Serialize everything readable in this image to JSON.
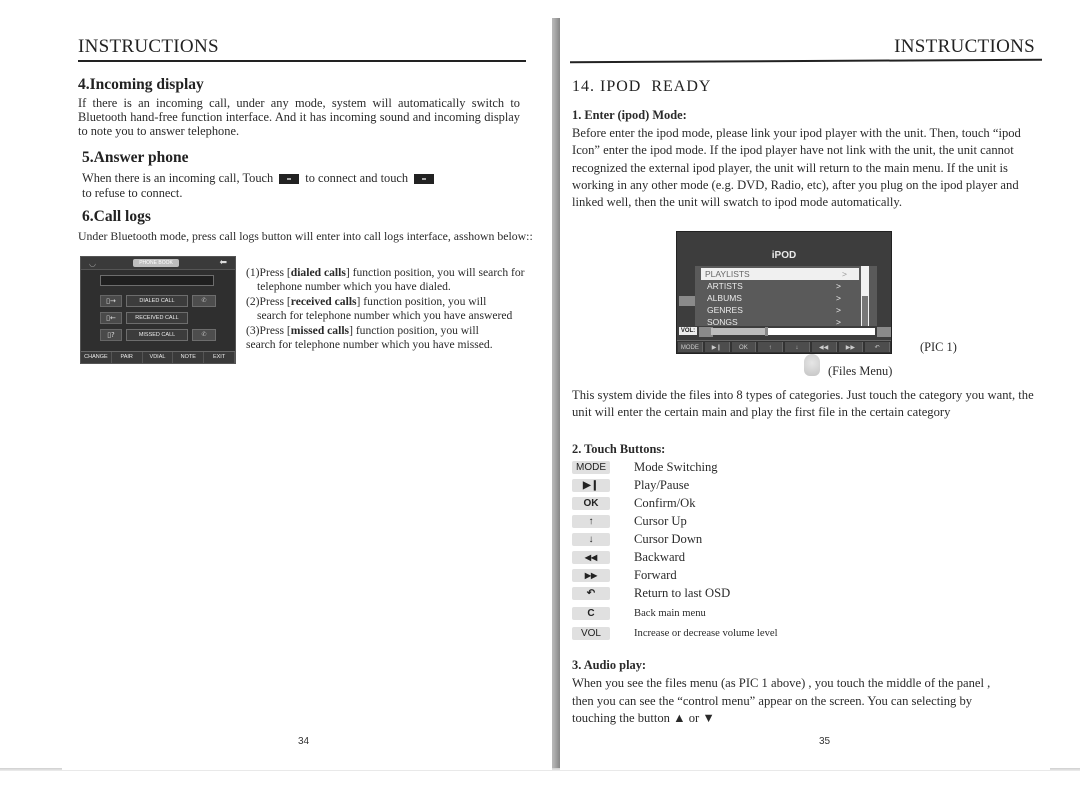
{
  "left_page": {
    "header": "INSTRUCTIONS",
    "sections": {
      "incoming": {
        "title": "4.Incoming display",
        "text": "If there is an incoming call, under any mode, system will automatically switch to Bluetooth hand-free function interface. And it has incoming sound and incoming display to note you to answer telephone."
      },
      "answer": {
        "title": "5.Answer phone",
        "text_part1": "When there is an incoming call, Touch",
        "text_part2": "to connect and touch",
        "text_part3": "to refuse to connect."
      },
      "call_logs": {
        "title": "6.Call logs",
        "text": "Under Bluetooth mode, press call logs button will enter into  call logs interface, asshown below::",
        "screen": {
          "phonebook_label": "PHONE BOOK",
          "back_icon": "back-arrow-icon",
          "rows": [
            {
              "label": "DIALED CALL",
              "icon": "phone-out-icon"
            },
            {
              "label": "RECEIVED CALL",
              "icon": "phone-in-icon"
            },
            {
              "label": "MISSED CALL",
              "icon": "phone-missed-icon"
            }
          ],
          "bottom_buttons": [
            "CHANGE",
            "PAIR",
            "VDIAL",
            "NOTE",
            "EXIT"
          ]
        },
        "items": [
          {
            "prefix": "(1)Press [",
            "bold": "dialed calls",
            "suffix": "] function position, you will search for",
            "line2": "telephone number which you have dialed."
          },
          {
            "prefix": "(2)Press [",
            "bold": "received calls",
            "suffix": "] function position, you will",
            "line2": "search for  telephone number which you have answered"
          },
          {
            "prefix": "(3)Press [",
            "bold": "missed calls",
            "suffix": "] function position, you will",
            "line2": "search for  telephone number which you have missed."
          }
        ]
      }
    },
    "page_number": "34"
  },
  "right_page": {
    "header": "INSTRUCTIONS",
    "section_title": "14. IPOD  READY",
    "enter_mode": {
      "title": "1. Enter (ipod) Mode:",
      "text": "Before enter the ipod mode, please link your ipod player with the unit. Then, touch “ipod Icon” enter the ipod mode. If the ipod player have not link with the unit, the unit cannot recognized  the external ipod player, the unit will return to the main menu. If the unit is working in any other mode (e.g. DVD, Radio, etc), after you plug on the ipod player and linked well, then the unit will swatch to ipod mode automatically."
    },
    "ipod_screen": {
      "title": "iPOD",
      "items": [
        "PLAYLISTS",
        "ARTISTS",
        "ALBUMS",
        "GENRES",
        "SONGS"
      ],
      "selected_index": 0,
      "vol_label": "VOL:",
      "volume_fraction": 0.33,
      "bottom_buttons": [
        "MODE",
        "▶❙",
        "OK",
        "↑",
        "↓",
        "◀◀",
        "▶▶",
        "↶"
      ]
    },
    "pic_label": "(PIC 1)",
    "files_menu_label": "(Files Menu)",
    "categories_text": "This system divide the files into 8 types of categories. Just touch the category you want, the unit will enter the certain main and play the first file in the certain category",
    "touch_buttons": {
      "title": "2. Touch Buttons:",
      "items": [
        {
          "key": "MODE",
          "desc": "Mode Switching",
          "icon": "mode-icon"
        },
        {
          "key": "▶❙",
          "desc": "Play/Pause",
          "icon": "play-pause-icon"
        },
        {
          "key": "OK",
          "desc": "Confirm/Ok",
          "icon": "ok-icon"
        },
        {
          "key": "↑",
          "desc": "Cursor Up",
          "icon": "arrow-up-icon"
        },
        {
          "key": "↓",
          "desc": "Cursor Down",
          "icon": "arrow-down-icon"
        },
        {
          "key": "◀◀",
          "desc": "Backward",
          "icon": "backward-icon"
        },
        {
          "key": "▶▶",
          "desc": "Forward",
          "icon": "forward-icon"
        },
        {
          "key": "↶",
          "desc": "Return to last OSD",
          "icon": "return-icon"
        },
        {
          "key": "C",
          "desc": "Back  main  menu",
          "icon": "back-main-icon"
        },
        {
          "key": "VOL",
          "desc": "Increase or decrease volume level",
          "icon": "volume-icon"
        }
      ]
    },
    "audio_play": {
      "title": "3. Audio play:",
      "text": "When you see the files menu (as PIC 1 above) , you touch the middle of the panel , then you can see the “control menu” appear on the screen. You can selecting by touching the button ▲ or ▼"
    },
    "page_number": "35"
  }
}
